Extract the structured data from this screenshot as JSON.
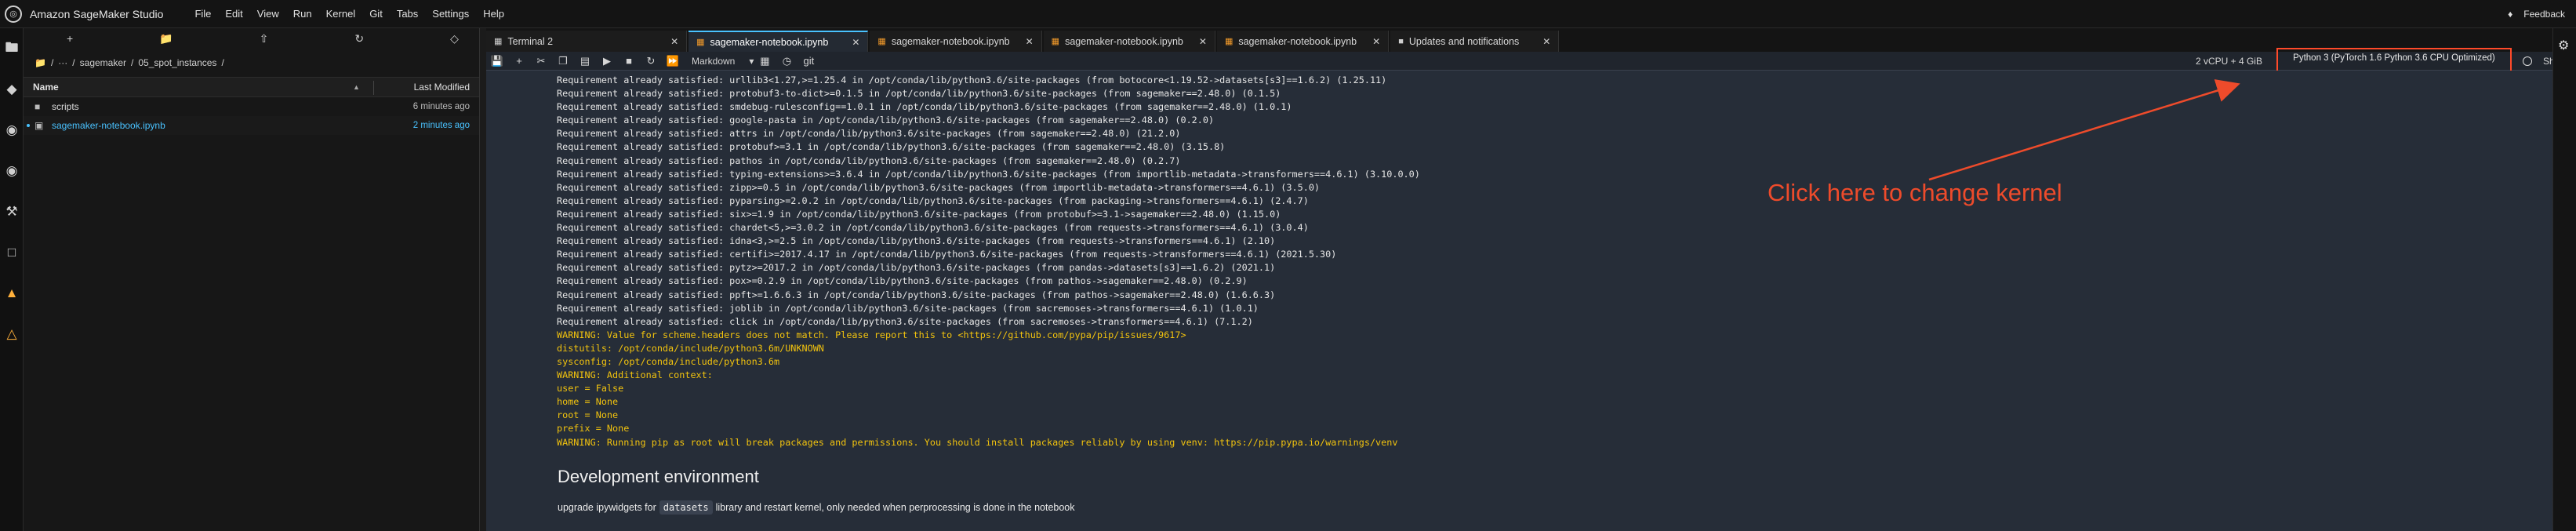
{
  "app": {
    "title": "Amazon SageMaker Studio",
    "menu": [
      "File",
      "Edit",
      "View",
      "Run",
      "Kernel",
      "Git",
      "Tabs",
      "Settings",
      "Help"
    ],
    "feedback_label": "Feedback"
  },
  "browser": {
    "breadcrumb": [
      "/",
      "···",
      "/",
      "sagemaker",
      "/",
      "05_spot_instances",
      "/"
    ],
    "header_name": "Name",
    "header_modified": "Last Modified",
    "items": [
      {
        "name": "scripts",
        "modified": "6 minutes ago",
        "icon": "folder-icon"
      },
      {
        "name": "sagemaker-notebook.ipynb",
        "modified": "2 minutes ago",
        "icon": "notebook-icon"
      }
    ]
  },
  "tabs": [
    {
      "label": "Terminal 2",
      "icon": "terminal-icon"
    },
    {
      "label": "sagemaker-notebook.ipynb",
      "icon": "notebook-icon",
      "active": true
    },
    {
      "label": "sagemaker-notebook.ipynb",
      "icon": "notebook-icon"
    },
    {
      "label": "sagemaker-notebook.ipynb",
      "icon": "notebook-icon"
    },
    {
      "label": "sagemaker-notebook.ipynb",
      "icon": "notebook-icon"
    },
    {
      "label": "Updates and notifications",
      "icon": "info-icon"
    }
  ],
  "toolbar": {
    "cell_type": "Markdown",
    "git_label": "git",
    "resources": "2 vCPU + 4 GiB",
    "kernel": "Python 3 (PyTorch 1.6 Python 3.6 CPU Optimized)",
    "share_label": "Share"
  },
  "output_lines": [
    {
      "kind": "ok",
      "text": "Requirement already satisfied: urllib3<1.27,>=1.25.4 in /opt/conda/lib/python3.6/site-packages (from botocore<1.19.52->datasets[s3]==1.6.2) (1.25.11)"
    },
    {
      "kind": "ok",
      "text": "Requirement already satisfied: protobuf3-to-dict>=0.1.5 in /opt/conda/lib/python3.6/site-packages (from sagemaker==2.48.0) (0.1.5)"
    },
    {
      "kind": "ok",
      "text": "Requirement already satisfied: smdebug-rulesconfig==1.0.1 in /opt/conda/lib/python3.6/site-packages (from sagemaker==2.48.0) (1.0.1)"
    },
    {
      "kind": "ok",
      "text": "Requirement already satisfied: google-pasta in /opt/conda/lib/python3.6/site-packages (from sagemaker==2.48.0) (0.2.0)"
    },
    {
      "kind": "ok",
      "text": "Requirement already satisfied: attrs in /opt/conda/lib/python3.6/site-packages (from sagemaker==2.48.0) (21.2.0)"
    },
    {
      "kind": "ok",
      "text": "Requirement already satisfied: protobuf>=3.1 in /opt/conda/lib/python3.6/site-packages (from sagemaker==2.48.0) (3.15.8)"
    },
    {
      "kind": "ok",
      "text": "Requirement already satisfied: pathos in /opt/conda/lib/python3.6/site-packages (from sagemaker==2.48.0) (0.2.7)"
    },
    {
      "kind": "ok",
      "text": "Requirement already satisfied: typing-extensions>=3.6.4 in /opt/conda/lib/python3.6/site-packages (from importlib-metadata->transformers==4.6.1) (3.10.0.0)"
    },
    {
      "kind": "ok",
      "text": "Requirement already satisfied: zipp>=0.5 in /opt/conda/lib/python3.6/site-packages (from importlib-metadata->transformers==4.6.1) (3.5.0)"
    },
    {
      "kind": "ok",
      "text": "Requirement already satisfied: pyparsing>=2.0.2 in /opt/conda/lib/python3.6/site-packages (from packaging->transformers==4.6.1) (2.4.7)"
    },
    {
      "kind": "ok",
      "text": "Requirement already satisfied: six>=1.9 in /opt/conda/lib/python3.6/site-packages (from protobuf>=3.1->sagemaker==2.48.0) (1.15.0)"
    },
    {
      "kind": "ok",
      "text": "Requirement already satisfied: chardet<5,>=3.0.2 in /opt/conda/lib/python3.6/site-packages (from requests->transformers==4.6.1) (3.0.4)"
    },
    {
      "kind": "ok",
      "text": "Requirement already satisfied: idna<3,>=2.5 in /opt/conda/lib/python3.6/site-packages (from requests->transformers==4.6.1) (2.10)"
    },
    {
      "kind": "ok",
      "text": "Requirement already satisfied: certifi>=2017.4.17 in /opt/conda/lib/python3.6/site-packages (from requests->transformers==4.6.1) (2021.5.30)"
    },
    {
      "kind": "ok",
      "text": "Requirement already satisfied: pytz>=2017.2 in /opt/conda/lib/python3.6/site-packages (from pandas->datasets[s3]==1.6.2) (2021.1)"
    },
    {
      "kind": "ok",
      "text": "Requirement already satisfied: pox>=0.2.9 in /opt/conda/lib/python3.6/site-packages (from pathos->sagemaker==2.48.0) (0.2.9)"
    },
    {
      "kind": "ok",
      "text": "Requirement already satisfied: ppft>=1.6.6.3 in /opt/conda/lib/python3.6/site-packages (from pathos->sagemaker==2.48.0) (1.6.6.3)"
    },
    {
      "kind": "ok",
      "text": "Requirement already satisfied: joblib in /opt/conda/lib/python3.6/site-packages (from sacremoses->transformers==4.6.1) (1.0.1)"
    },
    {
      "kind": "ok",
      "text": "Requirement already satisfied: click in /opt/conda/lib/python3.6/site-packages (from sacremoses->transformers==4.6.1) (7.1.2)"
    },
    {
      "kind": "warn",
      "text": "WARNING: Value for scheme.headers does not match. Please report this to <https://github.com/pypa/pip/issues/9617>"
    },
    {
      "kind": "warn",
      "text": "distutils: /opt/conda/include/python3.6m/UNKNOWN"
    },
    {
      "kind": "warn",
      "text": "sysconfig: /opt/conda/include/python3.6m"
    },
    {
      "kind": "warn",
      "text": "WARNING: Additional context:"
    },
    {
      "kind": "warn",
      "text": "user = False"
    },
    {
      "kind": "warn",
      "text": "home = None"
    },
    {
      "kind": "warn",
      "text": "root = None"
    },
    {
      "kind": "warn",
      "text": "prefix = None"
    },
    {
      "kind": "warn",
      "text": "WARNING: Running pip as root will break packages and permissions. You should install packages reliably by using venv: https://pip.pypa.io/warnings/venv"
    }
  ],
  "markdown": {
    "heading": "Development environment",
    "para_before": "upgrade ipywidgets for",
    "code": "datasets",
    "para_after": "library and restart kernel, only needed when perprocessing is done in the notebook"
  },
  "annotation": {
    "text": "Click here to change kernel",
    "color": "#ee4b2b"
  }
}
